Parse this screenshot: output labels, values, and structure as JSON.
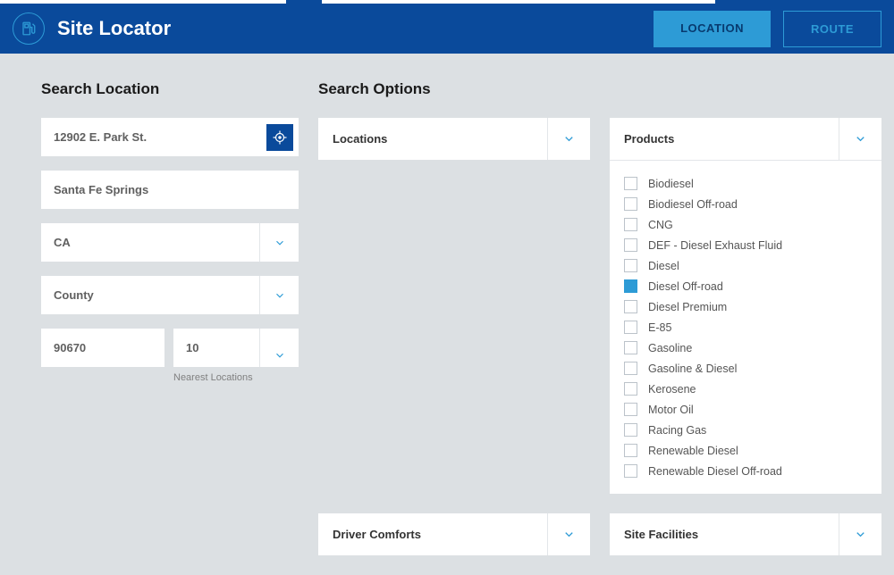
{
  "header": {
    "title": "Site Locator",
    "tabs": {
      "location": "LOCATION",
      "route": "ROUTE"
    }
  },
  "searchLocation": {
    "title": "Search Location",
    "address": "12902 E. Park St.",
    "city": "Santa Fe Springs",
    "state": "CA",
    "county_placeholder": "County",
    "zip": "90670",
    "nearest_value": "10",
    "nearest_label": "Nearest Locations"
  },
  "searchOptions": {
    "title": "Search Options",
    "panels": {
      "locations": "Locations",
      "products": "Products",
      "driverComforts": "Driver Comforts",
      "siteFacilities": "Site Facilities"
    },
    "products": [
      {
        "label": "Biodiesel",
        "checked": false
      },
      {
        "label": "Biodiesel Off-road",
        "checked": false
      },
      {
        "label": "CNG",
        "checked": false
      },
      {
        "label": "DEF - Diesel Exhaust Fluid",
        "checked": false
      },
      {
        "label": "Diesel",
        "checked": false
      },
      {
        "label": "Diesel Off-road",
        "checked": true
      },
      {
        "label": "Diesel Premium",
        "checked": false
      },
      {
        "label": "E-85",
        "checked": false
      },
      {
        "label": "Gasoline",
        "checked": false
      },
      {
        "label": "Gasoline & Diesel",
        "checked": false
      },
      {
        "label": "Kerosene",
        "checked": false
      },
      {
        "label": "Motor Oil",
        "checked": false
      },
      {
        "label": "Racing Gas",
        "checked": false
      },
      {
        "label": "Renewable Diesel",
        "checked": false
      },
      {
        "label": "Renewable Diesel Off-road",
        "checked": false
      }
    ]
  },
  "colors": {
    "primary": "#0a4a9b",
    "accent": "#2d9bd6"
  }
}
